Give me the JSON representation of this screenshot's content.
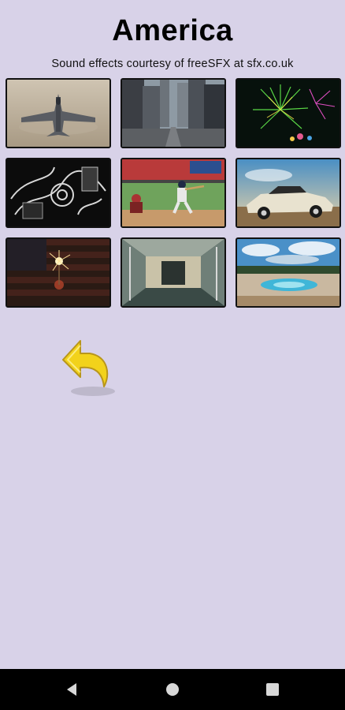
{
  "header": {
    "title": "America",
    "subtitle": "Sound effects courtesy of freeSFX at sfx.co.uk"
  },
  "tiles": [
    {
      "name": "tile-fighter-jet",
      "icon": "fighter-jet-image"
    },
    {
      "name": "tile-city-street",
      "icon": "city-street-image"
    },
    {
      "name": "tile-fireworks",
      "icon": "fireworks-image"
    },
    {
      "name": "tile-engine",
      "icon": "engine-image"
    },
    {
      "name": "tile-baseball",
      "icon": "baseball-image"
    },
    {
      "name": "tile-classic-car",
      "icon": "classic-car-image"
    },
    {
      "name": "tile-sparkler-flag",
      "icon": "sparkler-flag-image"
    },
    {
      "name": "tile-subway-train",
      "icon": "subway-train-image"
    },
    {
      "name": "tile-hot-spring",
      "icon": "hot-spring-image"
    }
  ],
  "controls": {
    "back_icon": "back-arrow-icon"
  },
  "navbar": {
    "back": "nav-back-icon",
    "home": "nav-home-icon",
    "recents": "nav-recents-icon"
  },
  "colors": {
    "background": "#d8d2e8",
    "accent": "#f2d21b",
    "navbar": "#000000"
  }
}
